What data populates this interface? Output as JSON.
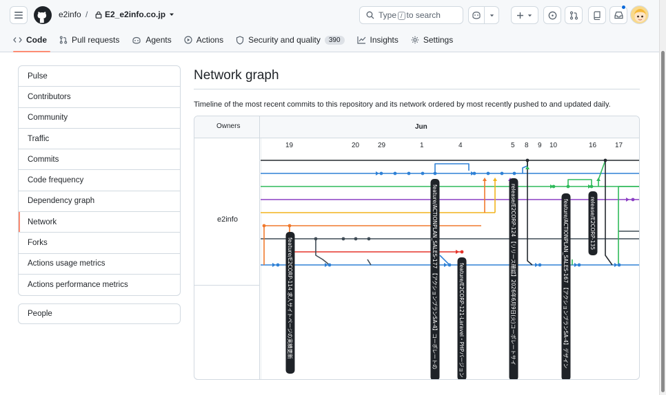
{
  "header": {
    "owner": "e2info",
    "separator": "/",
    "repo": "E2_e2info.co.jp",
    "search_prefix": "Type",
    "search_key": "/",
    "search_suffix": "to search"
  },
  "repo_nav": {
    "tabs": [
      {
        "label": "Code"
      },
      {
        "label": "Pull requests"
      },
      {
        "label": "Agents"
      },
      {
        "label": "Actions"
      },
      {
        "label": "Security and quality",
        "count": "390"
      },
      {
        "label": "Insights"
      },
      {
        "label": "Settings"
      }
    ]
  },
  "sidebar": {
    "items": [
      {
        "label": "Pulse"
      },
      {
        "label": "Contributors"
      },
      {
        "label": "Community"
      },
      {
        "label": "Traffic"
      },
      {
        "label": "Commits"
      },
      {
        "label": "Code frequency"
      },
      {
        "label": "Dependency graph"
      },
      {
        "label": "Network"
      },
      {
        "label": "Forks"
      },
      {
        "label": "Actions usage metrics"
      },
      {
        "label": "Actions performance metrics"
      }
    ],
    "people_label": "People"
  },
  "main": {
    "title": "Network graph",
    "description": "Timeline of the most recent commits to this repository and its network ordered by most recently pushed to and updated daily."
  },
  "graph": {
    "owners_header": "Owners",
    "month": "Jun",
    "owner": "e2info",
    "dates": [
      "19",
      "20",
      "29",
      "1",
      "4",
      "5",
      "8",
      "9",
      "10",
      "16",
      "17"
    ],
    "branch_labels": [
      "feature/E2CORP-114 求人サイトページの実績更新",
      "feature/ACTIONPLAN_SALES-177 【アクションプランSA-4】コーポレートの",
      "feature/E2CORP-121-Laravel・PHPバージョン",
      "release/E2CORP-124 【リリース確認】2026年6月9日(火)コーポレートサイ",
      "feature/ACTIONPLAN_SALES-167 【アクションプランSA-4】デザイン",
      "release/E2CORP-135"
    ],
    "colors": {
      "black": "#24292f",
      "blue": "#2f81d6",
      "green": "#2fba5a",
      "purple": "#8c3fc4",
      "yellow": "#f2b41c",
      "orange": "#f0782b",
      "slate": "#3f4b55",
      "red": "#e5332a"
    }
  }
}
